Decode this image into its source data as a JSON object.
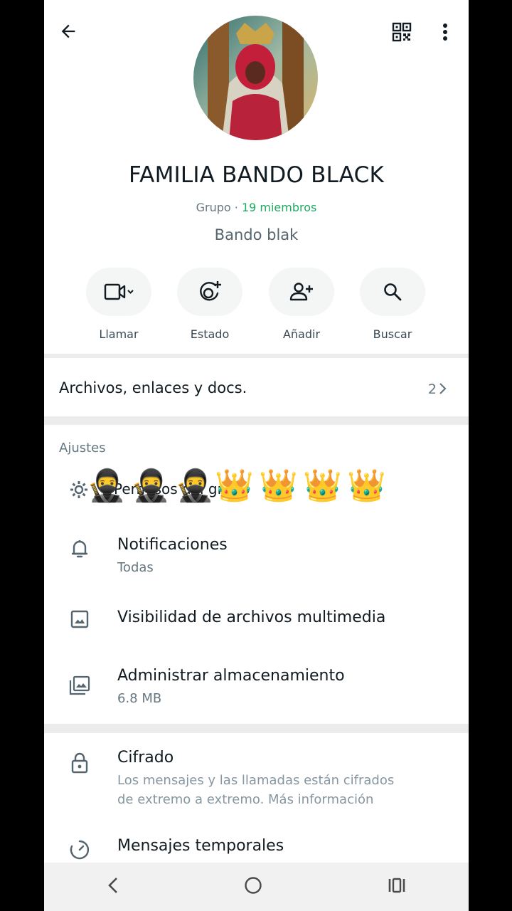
{
  "header": {
    "back_icon": "arrow-left-icon",
    "qr_icon": "qr-code-icon",
    "menu_icon": "more-vert-icon"
  },
  "group": {
    "name": "FAMILIA BANDO BLACK",
    "type": "Grupo",
    "separator": "·",
    "members": "19 miembros",
    "description": "Bando blak"
  },
  "actions": [
    {
      "label": "Llamar",
      "icon": "video-call-icon"
    },
    {
      "label": "Estado",
      "icon": "status-add-icon"
    },
    {
      "label": "Añadir",
      "icon": "add-person-icon"
    },
    {
      "label": "Buscar",
      "icon": "search-icon"
    }
  ],
  "files": {
    "label": "Archivos, enlaces y docs.",
    "count": "2"
  },
  "settings": {
    "title": "Ajustes",
    "permissions_label": "Permisos del grupo",
    "emojis": [
      "🥷",
      "🥷",
      "🥷",
      "👑",
      "👑",
      "👑",
      "👑"
    ],
    "items": [
      {
        "title": "Notificaciones",
        "subtitle": "Todas",
        "icon": "bell-icon"
      },
      {
        "title": "Visibilidad de archivos multimedia",
        "subtitle": "",
        "icon": "image-icon"
      },
      {
        "title": "Administrar almacenamiento",
        "subtitle": "6.8 MB",
        "icon": "storage-icon"
      }
    ]
  },
  "security": {
    "encryption_title": "Cifrado",
    "encryption_line1": "Los mensajes y las llamadas están cifrados",
    "encryption_line2": "de extremo a extremo. Más información",
    "temporal_title": "Mensajes temporales"
  },
  "colors": {
    "accent": "#1daa61",
    "text_primary": "#111b21",
    "text_secondary": "#667781"
  }
}
